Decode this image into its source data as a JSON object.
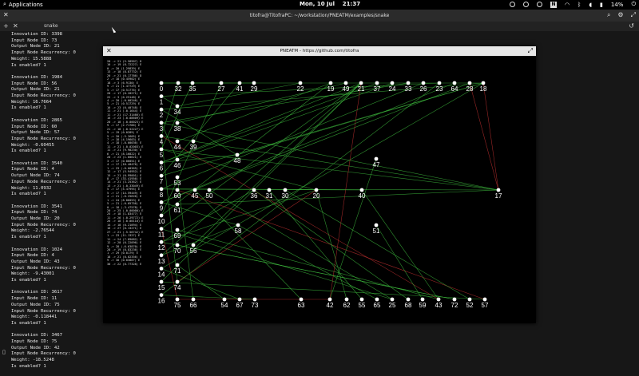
{
  "topbar": {
    "apps_label": "Applications",
    "date": "Mon, 10 Jul",
    "time": "21:37",
    "battery": "14%"
  },
  "terminal": {
    "title": "titofra@TitofraPC: ~/workstation/PNEATM/examples/snake",
    "tab_label": "snake",
    "records": [
      {
        "innovation": "Innovation ID: 3398",
        "input": "Input Node ID: 73",
        "output": "Output Node ID: 21",
        "recurrency": "Input Node Recurrency: 0",
        "weight": "Weight: 15.5888",
        "enabled": "Is enabled? 1"
      },
      {
        "innovation": "Innovation ID: 1984",
        "input": "Input Node ID: 56",
        "output": "Output Node ID: 21",
        "recurrency": "Input Node Recurrency: 0",
        "weight": "Weight: 16.7664",
        "enabled": "Is enabled? 1"
      },
      {
        "innovation": "Innovation ID: 2865",
        "input": "Input Node ID: 60",
        "output": "Output Node ID: 57",
        "recurrency": "Input Node Recurrency: 0",
        "weight": "Weight: -0.60455",
        "enabled": "Is enabled? 1"
      },
      {
        "innovation": "Innovation ID: 3540",
        "input": "Input Node ID: 4",
        "output": "Output Node ID: 74",
        "recurrency": "Input Node Recurrency: 0",
        "weight": "Weight: 11.0932",
        "enabled": "Is enabled? 1"
      },
      {
        "innovation": "Innovation ID: 3541",
        "input": "Input Node ID: 74",
        "output": "Output Node ID: 20",
        "recurrency": "Input Node Recurrency: 0",
        "weight": "Weight: -2.76544",
        "enabled": "Is enabled? 1"
      },
      {
        "innovation": "Innovation ID: 1024",
        "input": "Input Node ID: 4",
        "output": "Output Node ID: 43",
        "recurrency": "Input Node Recurrency: 0",
        "weight": "Weight: -9.43001",
        "enabled": "Is enabled? 1"
      },
      {
        "innovation": "Innovation ID: 3617",
        "input": "Input Node ID: 11",
        "output": "Output Node ID: 75",
        "recurrency": "Input Node Recurrency: 0",
        "weight": "Weight: -0.118441",
        "enabled": "Is enabled? 1"
      },
      {
        "innovation": "Innovation ID: 3467",
        "input": "Input Node ID: 75",
        "output": "Output Node ID: 42",
        "recurrency": "Input Node Recurrency: 0",
        "weight": "Weight: -18.5248",
        "enabled": "Is enabled? 1"
      }
    ]
  },
  "window": {
    "title": "PNEATM - https://github.com/titofra",
    "gene_list": [
      "20 -> 21 (5.58907) D",
      "10 -> 19 (8.72227) E",
      "0 -> 20 (1.29839) E",
      "13 -> 18 (8.87732) E",
      "20 -> 21 (0.17786) D",
      "2 -> 18 (0.45902) E",
      "18 -> 3 (6.9130) E",
      "9 -> 21 (1.47729) E",
      "5 -> 17 (0.51776) E",
      "20 -> 17 (0.20271) E",
      "22 -> 3 (0.25148) E",
      "4 -> 20 (-0.00246) E",
      "5 -> 21 (0.51729) E",
      "16 -> 23 (0.40748) E",
      "11 -> 21 (-0.1644) E",
      "11 -> 21 (17.31466) E",
      "16 -> 23 (-0.08609) E",
      "20 -> 18 (-0.00023) E",
      "9 -> 17 (2.71786) E",
      "21 -> 18 (-0.52227) E",
      "5 -> 19 (0.0289) E",
      "5 -> 20 (-5.2605) E",
      "7 -> 18 (4.19603) E",
      "4 -> 18 (-0.00036) E",
      "11 -> 21 (-0.02003) E",
      "11 -> 21 (9.98230) E",
      "6 -> 21 (8.16822) E",
      "20 -> 23 (1.60621) E",
      "3 -> 17 (0.06051) E",
      "4 -> 17 (18.40476) E",
      "1 -> 23 (-0.00365) E",
      "12 -> 17 (5.94952) E",
      "15 -> 21 (0.99001) E",
      "8 -> 17 (33.41956) E",
      "14 -> 21 (3.25362) E",
      "13 -> 21 (-0.33049) E",
      "5 -> 17 (5.47995) E",
      "5 -> 17 (14.59449) E",
      "4 -> 21 (-0.25626) E",
      "1 -> 24 (8.06053) E",
      "5 -> 21 (-0.05756) E",
      "0 -> 18 (-3.47578) E",
      "20 -> 25 (-0.00000) E",
      "25 -> 18 (1.83477) E",
      "11 -> 26 (-0.29772) E",
      "26 -> 18 (-0.00110) E",
      "14 -> 18 (0.21094) E",
      "16 -> 27 (0.13271) E",
      "27 -> 21 (-5.56742) E",
      "1 -> 23 (11.1327) E",
      "11 -> 24 (7.89082) E",
      "12 -> 20 (0.22096) E",
      "9 -> 28 (-6.63870) E",
      "28 -> 19 (0.83236) E",
      "1 -> 29 (0.0179) E",
      "18 -> 21 (0.02356) E",
      "9 -> 30 (0.03807) E",
      "30 -> 22 (0.77328) E"
    ],
    "nodes": {
      "inputs": [
        "0",
        "1",
        "2",
        "3",
        "4",
        "5",
        "6",
        "7",
        "8",
        "9",
        "10",
        "11",
        "12",
        "13",
        "14",
        "15",
        "16"
      ],
      "top_row": [
        "32",
        "35",
        "27",
        "41",
        "29",
        "22",
        "19",
        "49",
        "21",
        "37",
        "24",
        "33",
        "26",
        "23",
        "64",
        "28",
        "18"
      ],
      "mid_row": [
        "60",
        "45",
        "50",
        "36",
        "31",
        "30",
        "20",
        "40",
        "17"
      ],
      "bottom_row": [
        "75",
        "66",
        "54",
        "67",
        "73",
        "63",
        "42",
        "62",
        "55",
        "65",
        "25",
        "68",
        "59",
        "43",
        "72",
        "52",
        "57"
      ],
      "hidden": [
        "34",
        "38",
        "44",
        "39",
        "46",
        "48",
        "47",
        "53",
        "61",
        "58",
        "51",
        "69",
        "70",
        "56",
        "71",
        "74"
      ]
    },
    "colors": {
      "positive_edge": "#3fbf3f",
      "negative_edge": "#c83232",
      "node_fill": "#ffffff",
      "canvas_bg": "#000000"
    }
  },
  "shell": {
    "prompt": "▯"
  }
}
